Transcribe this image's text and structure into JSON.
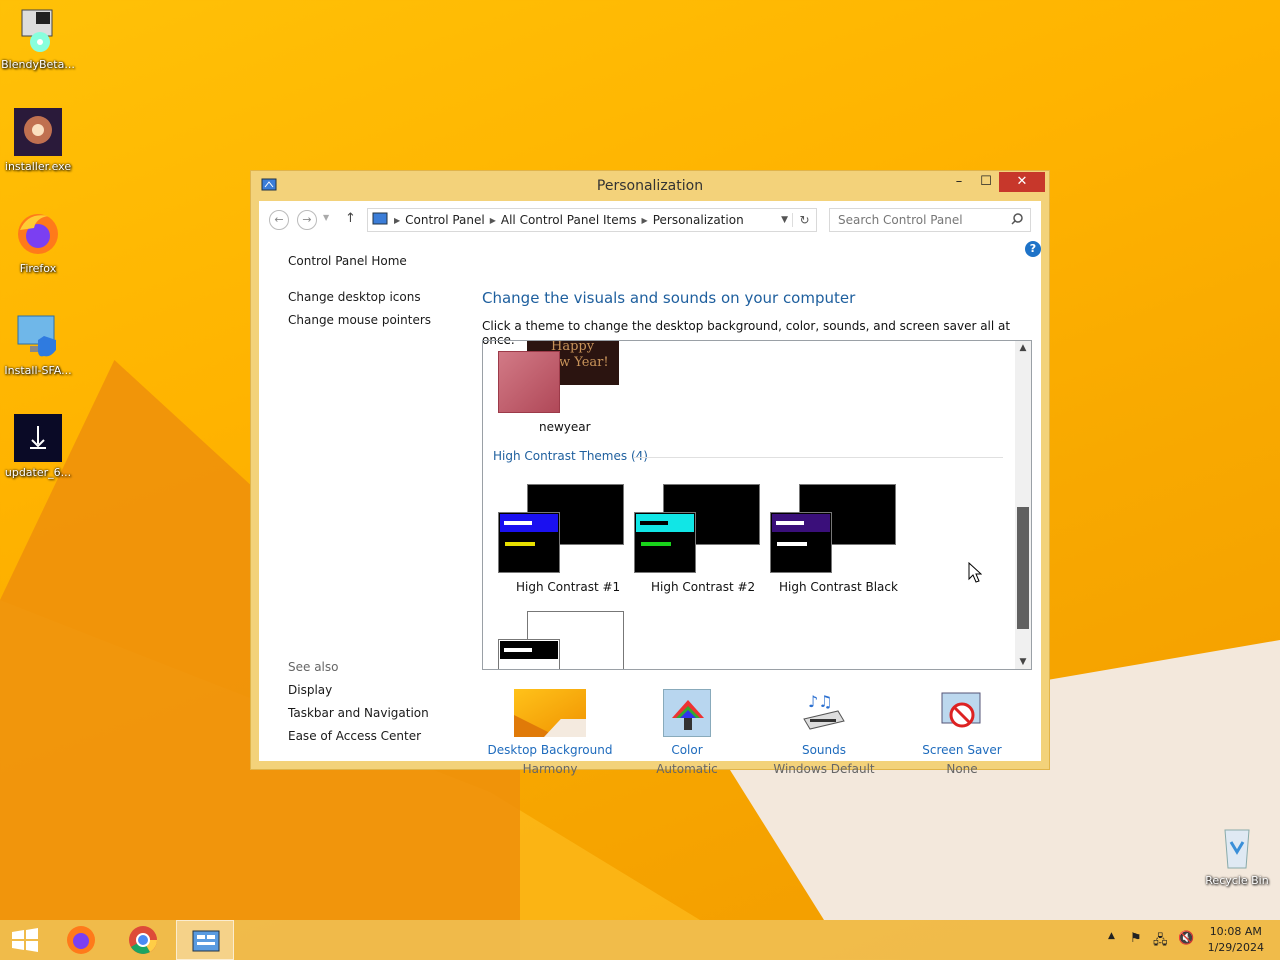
{
  "desktop": {
    "icons": [
      {
        "label": "BlendyBeta..."
      },
      {
        "label": "installer.exe"
      },
      {
        "label": "Firefox"
      },
      {
        "label": "Install-SFA..."
      },
      {
        "label": "updater_6..."
      },
      {
        "label": "Recycle Bin"
      }
    ]
  },
  "window": {
    "title": "Personalization",
    "minimize": "–",
    "maximize": "☐",
    "close": "✕"
  },
  "addressbar": {
    "back": "←",
    "forward": "→",
    "up": "↑",
    "crumbs": [
      "Control Panel",
      "All Control Panel Items",
      "Personalization"
    ],
    "search_placeholder": "Search Control Panel"
  },
  "left_nav": {
    "home": "Control Panel Home",
    "items": [
      "Change desktop icons",
      "Change mouse pointers"
    ],
    "see_also_title": "See also",
    "see_also": [
      "Display",
      "Taskbar and Navigation",
      "Ease of Access Center"
    ]
  },
  "main": {
    "heading": "Change the visuals and sounds on your computer",
    "subtitle": "Click a theme to change the desktop background, color, sounds, and screen saver all at once.",
    "help": "?",
    "newyear_theme": {
      "label": "newyear",
      "preview_text_1": "Happy",
      "preview_text_2": "w Year!"
    },
    "high_contrast_group": "High Contrast Themes (4)",
    "high_contrast_themes": [
      {
        "label": "High Contrast #1",
        "accent": "#1a10f0",
        "bar": "#e8e000"
      },
      {
        "label": "High Contrast #2",
        "accent": "#11e6e6",
        "bar": "#19d41b"
      },
      {
        "label": "High Contrast Black",
        "accent": "#3a0f7a",
        "bar": "#ffffff"
      }
    ]
  },
  "bottom": [
    {
      "label": "Desktop Background",
      "value": "Harmony"
    },
    {
      "label": "Color",
      "value": "Automatic"
    },
    {
      "label": "Sounds",
      "value": "Windows Default"
    },
    {
      "label": "Screen Saver",
      "value": "None"
    }
  ],
  "taskbar": {
    "time": "10:08 AM",
    "date": "1/29/2024"
  }
}
